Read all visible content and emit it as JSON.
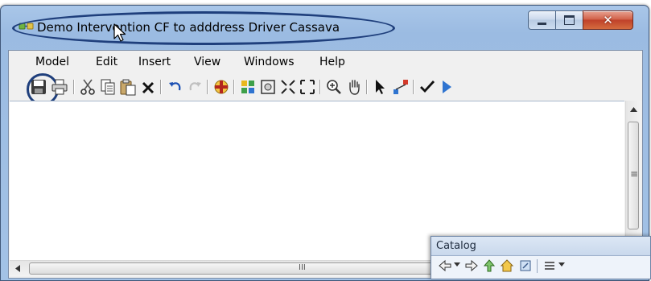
{
  "window": {
    "title": "Demo Intervention CF to adddress Driver Cassava",
    "minimize_symbol": "–",
    "close_symbol": "✕"
  },
  "menu": {
    "items": [
      "Model",
      "Edit",
      "Insert",
      "View",
      "Windows",
      "Help"
    ]
  },
  "toolbar": {
    "icons": [
      "save-icon",
      "print-icon",
      "cut-icon",
      "copy-icon",
      "paste-icon",
      "delete-icon",
      "undo-icon",
      "redo-icon",
      "add-data-icon",
      "auto-layout-icon",
      "full-extent-icon",
      "zoom-in-fixed-icon",
      "zoom-out-fixed-icon",
      "zoom-in-icon",
      "pan-icon",
      "select-icon",
      "connect-icon",
      "validate-icon",
      "run-icon"
    ]
  },
  "scrollbar": {
    "grip": "≡",
    "hgrip": "III"
  },
  "catalog": {
    "title": "Catalog"
  },
  "colors": {
    "title_bar": "#a3c2e6",
    "highlight_ring": "#1f3f7c",
    "close_button": "#c0412a",
    "run_arrow": "#2f74d0"
  }
}
